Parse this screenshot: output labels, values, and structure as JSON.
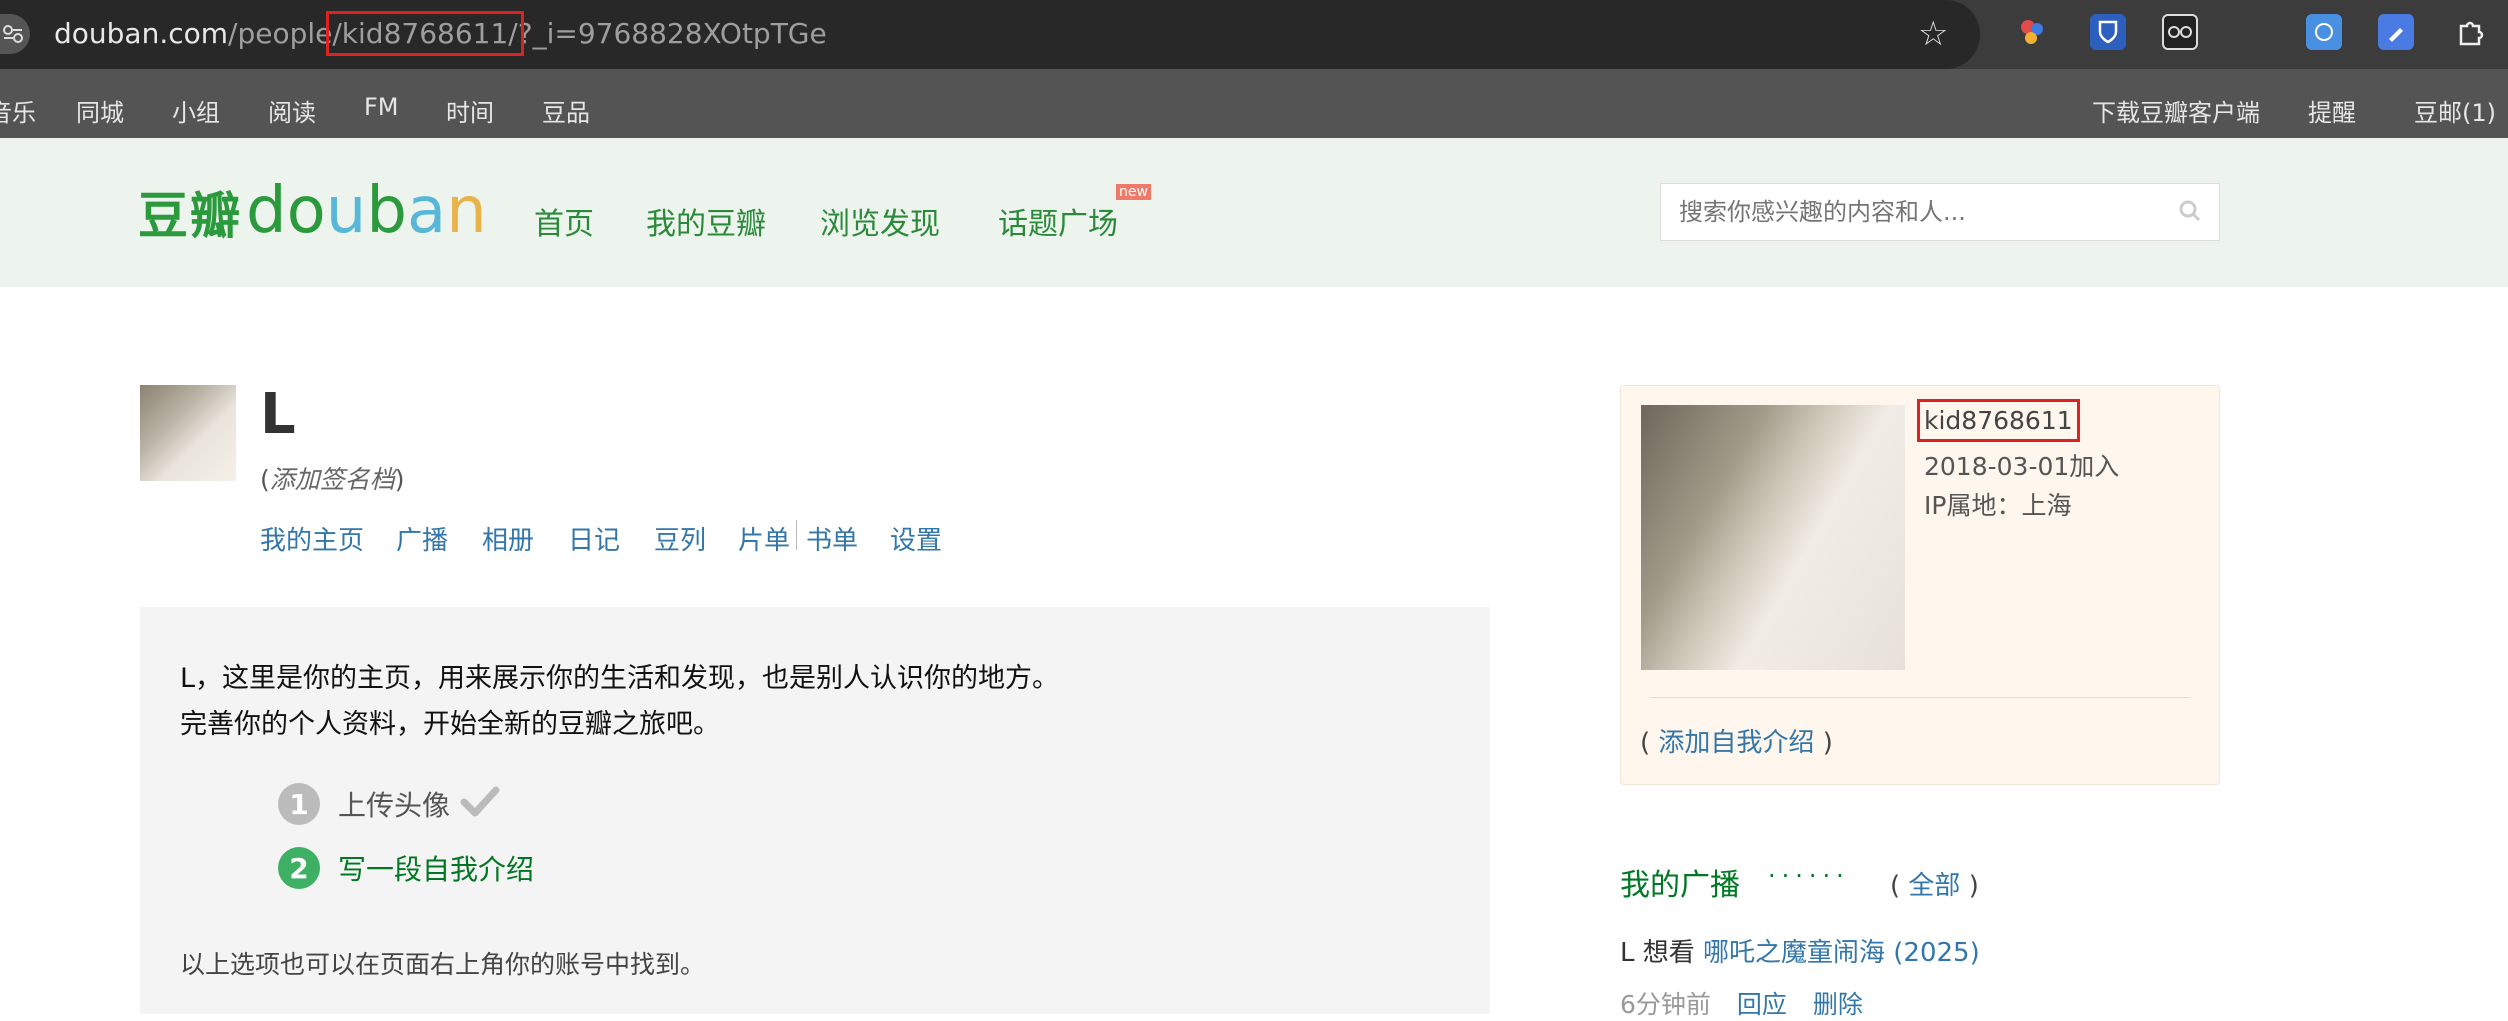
{
  "browser": {
    "url_host": "douban.com",
    "url_path1": "/people",
    "url_path_highlight": "/kid8768611/",
    "url_query": "?_i=9768828XOtpTGe"
  },
  "topnav": {
    "items": [
      "音乐",
      "同城",
      "小组",
      "阅读",
      "FM",
      "时间",
      "豆品"
    ],
    "right": [
      "下载豆瓣客户端",
      "提醒",
      "豆邮(1)"
    ]
  },
  "header": {
    "logo_cn": "豆瓣",
    "logo_en": [
      "d",
      "o",
      "u",
      "b",
      "a",
      "n"
    ],
    "nav": [
      "首页",
      "我的豆瓣",
      "浏览发现",
      "话题广场"
    ],
    "new_badge": "new",
    "search_placeholder": "搜索你感兴趣的内容和人..."
  },
  "profile": {
    "name": "L",
    "signature_open": "(",
    "signature_text": "添加签名档",
    "signature_close": ")",
    "subnav": [
      "我的主页",
      "广播",
      "相册",
      "日记",
      "豆列",
      "片单",
      "书单",
      "设置"
    ]
  },
  "intro": {
    "line1": "L，这里是你的主页，用来展示你的生活和发现，也是别人认识你的地方。",
    "line2": "完善你的个人资料，开始全新的豆瓣之旅吧。",
    "steps": [
      {
        "num": "1",
        "label": "上传头像",
        "done": true,
        "color": "#bbbbbb"
      },
      {
        "num": "2",
        "label": "写一段自我介绍",
        "done": false,
        "color": "#3eb063"
      }
    ],
    "footer": "以上选项也可以在页面右上角你的账号中找到。"
  },
  "card": {
    "uid": "kid8768611",
    "joined": "2018-03-01加入",
    "ip": "IP属地：上海",
    "add_intro_open": "( ",
    "add_intro_link": "添加自我介绍",
    "add_intro_close": " )"
  },
  "broadcast": {
    "title": "我的广播",
    "dots": "······",
    "all_open": "( ",
    "all_link": "全部",
    "all_close": " )",
    "item_user": "L 想看 ",
    "item_movie": "哪吒之魔童闹海 (2025)",
    "time": "6分钟前",
    "reply": "回应",
    "delete": "删除"
  }
}
